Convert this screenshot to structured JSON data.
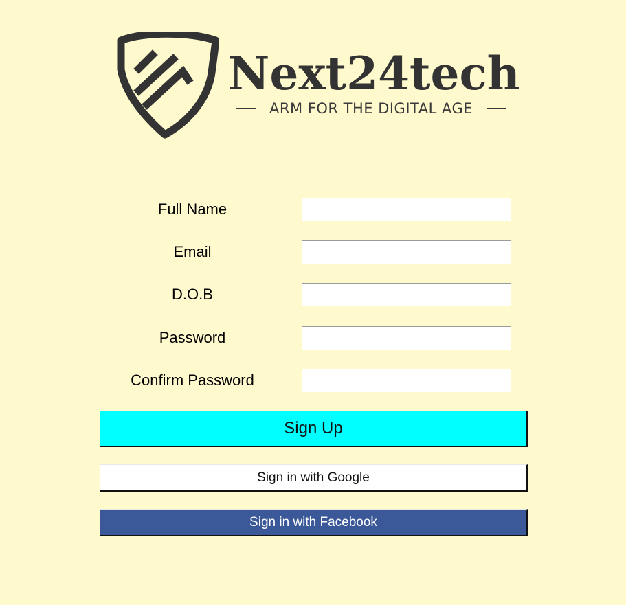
{
  "brand": {
    "name": "Next24tech",
    "tagline": "ARM FOR THE DIGITAL AGE"
  },
  "form": {
    "fields": [
      {
        "label": "Full Name",
        "value": "",
        "type": "text"
      },
      {
        "label": "Email",
        "value": "",
        "type": "email"
      },
      {
        "label": "D.O.B",
        "value": "",
        "type": "text"
      },
      {
        "label": "Password",
        "value": "",
        "type": "password"
      },
      {
        "label": "Confirm Password",
        "value": "",
        "type": "password"
      }
    ]
  },
  "buttons": {
    "signup_label": "Sign Up",
    "google_label": "Sign in with Google",
    "facebook_label": "Sign in with Facebook"
  },
  "colors": {
    "page_background": "#fffacd",
    "signup_button": "#00ffff",
    "google_button": "#ffffff",
    "facebook_button": "#3b5998",
    "logo": "#333333"
  },
  "icons": {
    "logo": "shield-stripes-icon"
  }
}
